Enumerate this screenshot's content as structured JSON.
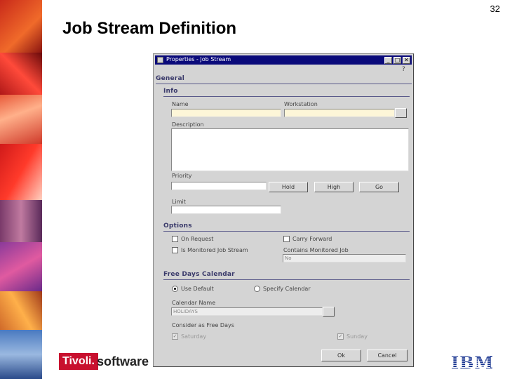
{
  "slide": {
    "title": "Job Stream Definition",
    "page_number": "32"
  },
  "window": {
    "title": "Properties - Job Stream",
    "controls": {
      "minimize": "_",
      "maximize": "□",
      "close": "✕"
    }
  },
  "general": {
    "heading": "General",
    "info": {
      "heading": "Info",
      "name_label": "Name",
      "name_value": "",
      "workstation_label": "Workstation",
      "workstation_value": "",
      "description_label": "Description",
      "priority_label": "Priority",
      "hold_button": "Hold",
      "high_button": "High",
      "go_button": "Go",
      "limit_label": "Limit"
    },
    "options": {
      "heading": "Options",
      "on_request": "On Request",
      "carry_forward": "Carry Forward",
      "monitored": "Is Monitored Job Stream",
      "contains_monitored_label": "Contains Monitored Job",
      "contains_monitored_value": "No"
    },
    "free_days": {
      "heading": "Free Days Calendar",
      "use_default": "Use Default",
      "specify_calendar": "Specify Calendar",
      "calendar_name_label": "Calendar Name",
      "calendar_name_value": "HOLIDAYS",
      "consider_label": "Consider as Free Days",
      "saturday": "Saturday",
      "sunday": "Sunday"
    },
    "ok_button": "Ok",
    "cancel_button": "Cancel"
  },
  "logos": {
    "tivoli": "Tivoli.",
    "software": "software",
    "ibm": "IBM"
  },
  "colors": {
    "title_bar": "#0a0a7a",
    "section_heading": "#3a3a6a",
    "required_field": "#fdf6d8",
    "tivoli_red": "#c8102e",
    "ibm_blue": "#1f3a93"
  }
}
